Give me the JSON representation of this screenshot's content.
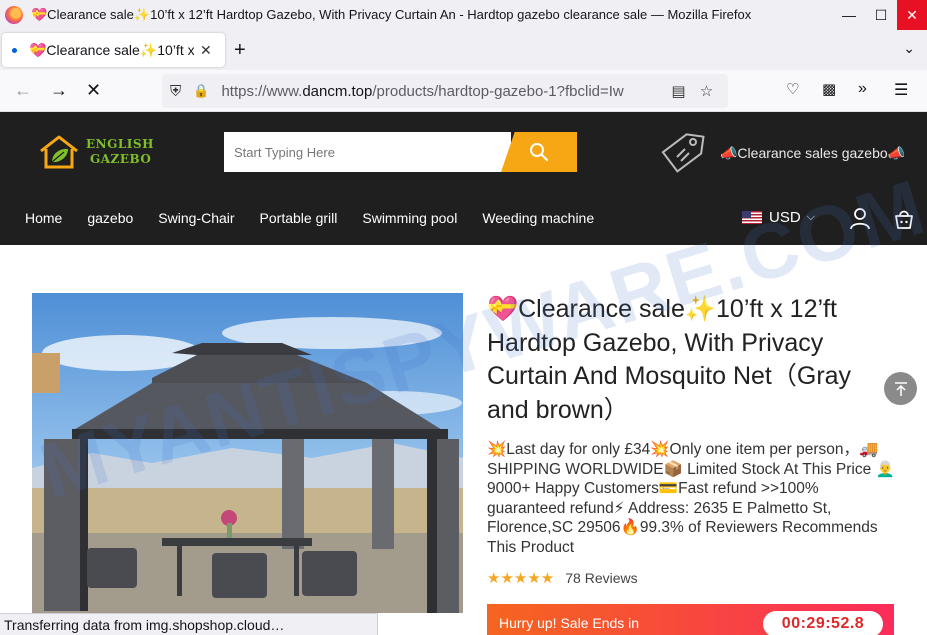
{
  "browser": {
    "window_title": "💝Clearance sale✨10’ft x 12’ft Hardtop Gazebo, With Privacy Curtain An - Hardtop gazebo clearance sale — Mozilla Firefox",
    "tab_title": "💝Clearance sale✨10’ft x 12’ft Hardtop Gazebo, With Privacy Curtain An",
    "url_prefix": "https://www.",
    "url_domain": "dancm.top",
    "url_rest": "/products/hardtop-gazebo-1?fbclid=Iw",
    "status_text": "Transferring data from img.shopshop.cloud…"
  },
  "site": {
    "logo_line1": "ENGLISH",
    "logo_line2": "GAZEBO",
    "search_placeholder": "Start Typing Here",
    "promo_text": "📣Clearance sales gazebo📣",
    "menu": [
      "Home",
      "gazebo",
      "Swing-Chair",
      "Portable grill",
      "Swimming pool",
      "Weeding machine"
    ],
    "currency": "USD"
  },
  "product": {
    "title": "💝Clearance sale✨10’ft x 12’ft Hardtop Gazebo, With Privacy Curtain And Mosquito Net（Gray and brown）",
    "description": "💥Last day for only £34💥Only one item per person，🚚 SHIPPING WORLDWIDE📦 Limited Stock At This Price 👨‍🦳9000+ Happy Customers💳Fast refund >>100% guaranteed refund⚡ Address: 2635 E Palmetto St, Florence,SC 29506🔥99.3% of Reviewers Recommends This Product",
    "stars": "★★★★★",
    "rating_value": 5,
    "reviews": "78 Reviews",
    "sale_text": "Hurry up! Sale Ends in",
    "timer": "00:29:52.8"
  },
  "watermark": "MYANTISPYWARE.COM",
  "colors": {
    "header_bg": "#1f1f1f",
    "search_accent": "#f7a713",
    "sale_gradient_start": "#f5651f",
    "sale_gradient_end": "#fb2c5b",
    "timer_text": "#e0282a"
  }
}
